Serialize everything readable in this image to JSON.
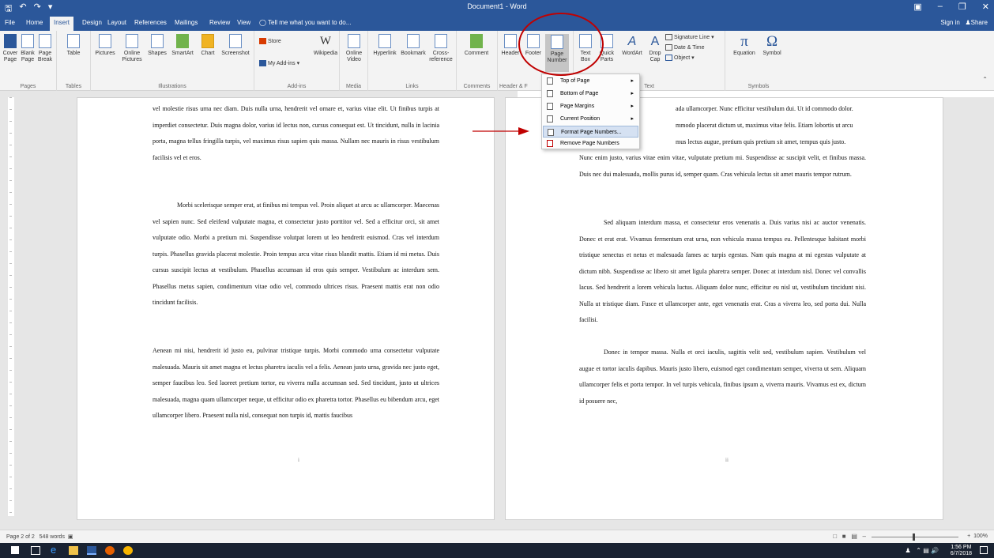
{
  "title_bar": {
    "document_title": "Document1 - Word",
    "quick_access": [
      "save",
      "undo",
      "redo",
      "customize"
    ]
  },
  "tabs": [
    {
      "label": "File"
    },
    {
      "label": "Home"
    },
    {
      "label": "Insert"
    },
    {
      "label": "Design"
    },
    {
      "label": "Layout"
    },
    {
      "label": "References"
    },
    {
      "label": "Mailings"
    },
    {
      "label": "Review"
    },
    {
      "label": "View"
    },
    {
      "label": "Tell me what you want to do..."
    }
  ],
  "active_tab": "Insert",
  "account": {
    "sign_in": "Sign in",
    "share": "Share"
  },
  "ribbon": {
    "pages": {
      "label": "Pages",
      "cover": "Cover\nPage",
      "blank": "Blank\nPage",
      "break": "Page\nBreak"
    },
    "tables": {
      "label": "Tables",
      "table": "Table"
    },
    "illustrations": {
      "label": "Illustrations",
      "pictures": "Pictures",
      "online_pictures": "Online\nPictures",
      "shapes": "Shapes",
      "smartart": "SmartArt",
      "chart": "Chart",
      "screenshot": "Screenshot"
    },
    "addins": {
      "label": "Add-ins",
      "store": "Store",
      "my_addins": "My Add-ins",
      "wikipedia": "Wikipedia"
    },
    "media": {
      "label": "Media",
      "online_video": "Online\nVideo"
    },
    "links": {
      "label": "Links",
      "hyperlink": "Hyperlink",
      "bookmark": "Bookmark",
      "cross_reference": "Cross-\nreference"
    },
    "comments": {
      "label": "Comments",
      "comment": "Comment"
    },
    "header_footer": {
      "label": "Header & F",
      "header": "Header",
      "footer": "Footer",
      "page_number": "Page\nNumber"
    },
    "text": {
      "label": "Text",
      "text_box": "Text\nBox",
      "quick_parts": "Quick\nParts",
      "wordart": "WordArt",
      "drop_cap": "Drop\nCap",
      "signature_line": "Signature Line",
      "date_time": "Date & Time",
      "object": "Object"
    },
    "symbols": {
      "label": "Symbols",
      "equation": "Equation",
      "symbol": "Symbol"
    }
  },
  "dropdown": {
    "items": [
      {
        "label": "Top of Page",
        "submenu": true
      },
      {
        "label": "Bottom of Page",
        "submenu": true
      },
      {
        "label": "Page Margins",
        "submenu": true
      },
      {
        "label": "Current Position",
        "submenu": true
      },
      {
        "label": "Format Page Numbers...",
        "submenu": false,
        "highlighted": true
      },
      {
        "label": "Remove Page Numbers",
        "submenu": false
      }
    ]
  },
  "page1": {
    "page_number": "i",
    "paragraphs": [
      "vel molestie risus urna nec diam. Duis nulla urna, hendrerit vel ornare et, varius vitae elit. Ut finibus turpis at imperdiet consectetur. Duis magna dolor, varius id lectus non, cursus consequat est. Ut tincidunt, nulla in lacinia porta, magna tellus fringilla turpis, vel maximus risus sapien quis massa. Nullam nec mauris in risus vestibulum facilisis vel et eros.",
      "Morbi scelerisque semper erat, at finibus mi tempus vel. Proin aliquet at arcu ac ullamcorper. Maecenas vel sapien nunc. Sed eleifend vulputate magna, et consectetur justo porttitor vel. Sed a efficitur orci, sit amet vulputate odio. Morbi a pretium mi. Suspendisse volutpat lorem ut leo hendrerit euismod. Cras vel interdum turpis. Phasellus gravida placerat molestie. Proin tempus arcu vitae risus blandit mattis. Etiam id mi metus. Duis cursus suscipit lectus at vestibulum. Phasellus accumsan id eros quis semper. Vestibulum ac interdum sem. Phasellus metus sapien, condimentum vitae odio vel, commodo ultrices risus. Praesent mattis erat non odio tincidunt facilisis.",
      "Aenean mi nisi, hendrerit id justo eu, pulvinar tristique turpis. Morbi commodo urna consectetur vulputate malesuada. Mauris sit amet magna et lectus pharetra iaculis vel a felis. Aenean justo urna, gravida nec justo eget, semper faucibus leo. Sed laoreet pretium tortor, eu viverra nulla accumsan sed. Sed tincidunt, justo ut ultrices malesuada, magna quam ullamcorper neque, ut efficitur odio ex pharetra tortor. Phasellus eu bibendum arcu, eget ullamcorper libero. Praesent nulla nisl, consequat non turpis id, mattis faucibus"
    ]
  },
  "page2": {
    "page_number": "ii",
    "paragraphs": [
      "ada ullamcorper. Nunc efficitur vestibulum dui. Ut id commodo dolor.",
      "mmodo placerat dictum ut, maximus vitae felis. Etiam lobortis ut arcu",
      "mus lectus augue, pretium quis pretium sit amet, tempus quis justo.",
      "Nunc enim justo, varius vitae enim vitae, vulputate pretium mi. Suspendisse ac suscipit velit, et finibus massa. Duis nec dui malesuada, mollis purus id, semper quam. Cras vehicula lectus sit amet mauris tempor rutrum.",
      "Sed aliquam interdum massa, et consectetur eros venenatis a. Duis varius nisi ac auctor venenatis. Donec et erat erat. Vivamus fermentum erat urna, non vehicula massa tempus eu. Pellentesque habitant morbi tristique senectus et netus et malesuada fames ac turpis egestas. Nam quis magna at mi egestas vulputate at dictum nibh. Suspendisse ac libero sit amet ligula pharetra semper. Donec at interdum nisl. Donec vel convallis lacus. Sed hendrerit a lorem vehicula luctus. Aliquam dolor nunc, efficitur eu nisl ut, vestibulum tincidunt nisi. Nulla ut tristique diam. Fusce et ullamcorper ante, eget venenatis erat. Cras a viverra leo, sed porta dui. Nulla facilisi.",
      "Donec in tempor massa. Nulla et orci iaculis, sagittis velit sed, vestibulum sapien. Vestibulum vel augue et tortor iaculis dapibus. Mauris justo libero, euismod eget condimentum semper, viverra ut sem. Aliquam ullamcorper felis et porta tempor. In vel turpis vehicula, finibus ipsum a, viverra mauris. Vivamus est ex, dictum id posuere nec,"
    ]
  },
  "status": {
    "page": "Page 2 of 2",
    "words": "548 words",
    "zoom": "100%"
  },
  "taskbar": {
    "time": "1:56 PM",
    "date": "6/7/2018"
  },
  "colors": {
    "word_blue": "#2b579a",
    "annotation_red": "#c00000",
    "highlight": "#d5e1f2"
  }
}
